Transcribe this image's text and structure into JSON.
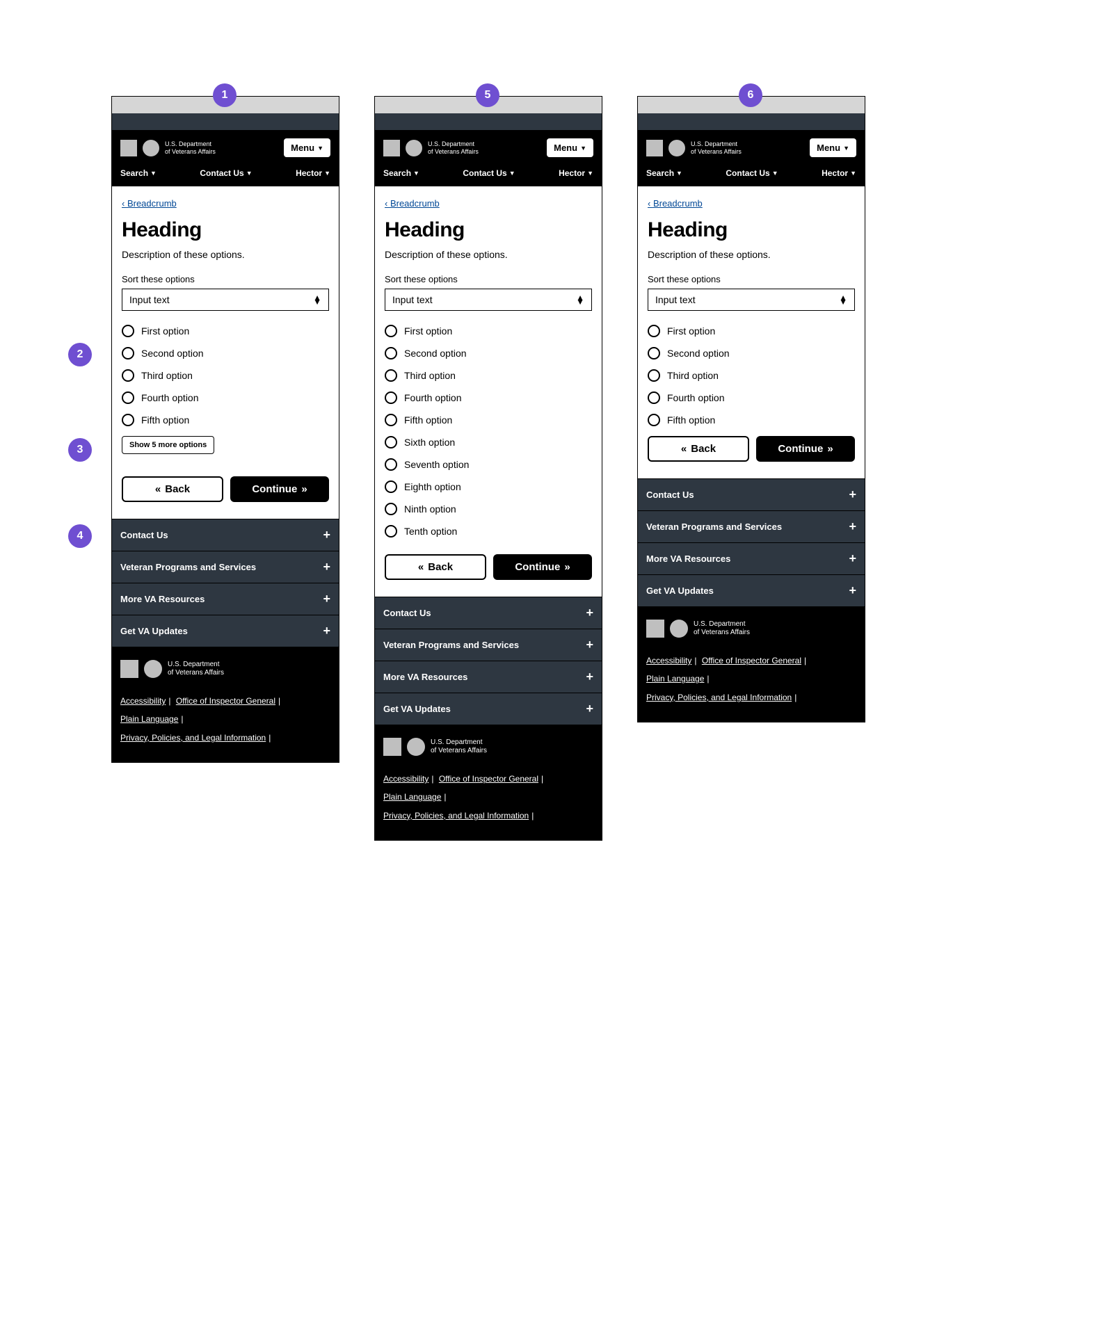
{
  "annotations": [
    "1",
    "2",
    "3",
    "4",
    "5",
    "6"
  ],
  "header": {
    "dept_line1": "U.S. Department",
    "dept_line2": "of Veterans Affairs",
    "menu_label": "Menu",
    "nav": {
      "search": "Search",
      "contact": "Contact Us",
      "user": "Hector"
    }
  },
  "breadcrumb_prefix": "‹ ",
  "breadcrumb": "Breadcrumb",
  "heading": "Heading",
  "description": "Description of these options.",
  "sort_label": "Sort these options",
  "select_value": "Input text",
  "options10": [
    "First option",
    "Second option",
    "Third option",
    "Fourth option",
    "Fifth option",
    "Sixth option",
    "Seventh option",
    "Eighth option",
    "Ninth option",
    "Tenth option"
  ],
  "show_more_label": "Show 5 more options",
  "back_label": "Back",
  "continue_label": "Continue",
  "accordion": [
    "Contact Us",
    "Veteran Programs and Services",
    "More VA Resources",
    "Get VA Updates"
  ],
  "footer": {
    "dept_line1": "U.S. Department",
    "dept_line2": "of Veterans Affairs",
    "links": {
      "accessibility": "Accessibility",
      "oig": "Office of Inspector General",
      "plain": "Plain Language",
      "privacy": "Privacy, Policies, and Legal Information"
    }
  }
}
